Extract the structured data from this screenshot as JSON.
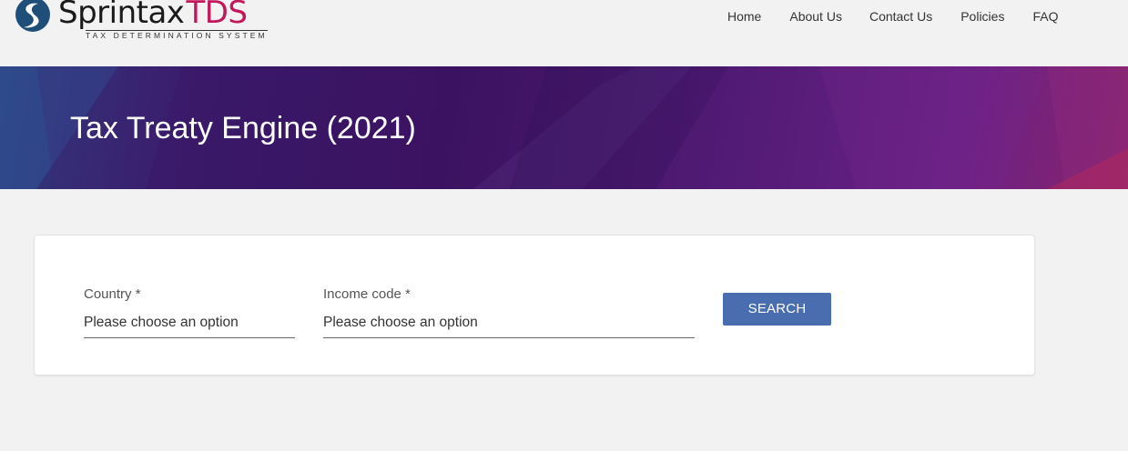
{
  "header": {
    "logo": {
      "wordmark": "Sprintax",
      "brand_suffix": "TDS",
      "tagline": "TAX DETERMINATION SYSTEM"
    },
    "nav": [
      {
        "label": "Home"
      },
      {
        "label": "About Us"
      },
      {
        "label": "Contact Us"
      },
      {
        "label": "Policies"
      },
      {
        "label": "FAQ"
      }
    ]
  },
  "banner": {
    "title": "Tax Treaty Engine (2021)"
  },
  "form": {
    "country": {
      "label": "Country *",
      "value": "Please choose an option"
    },
    "income_code": {
      "label": "Income code *",
      "value": "Please choose an option"
    },
    "search_label": "SEARCH"
  },
  "colors": {
    "brand_pink": "#c2185b",
    "logo_blue": "#1f4e79",
    "button_blue": "#4a6db0",
    "banner_purple": "#3b1261"
  }
}
